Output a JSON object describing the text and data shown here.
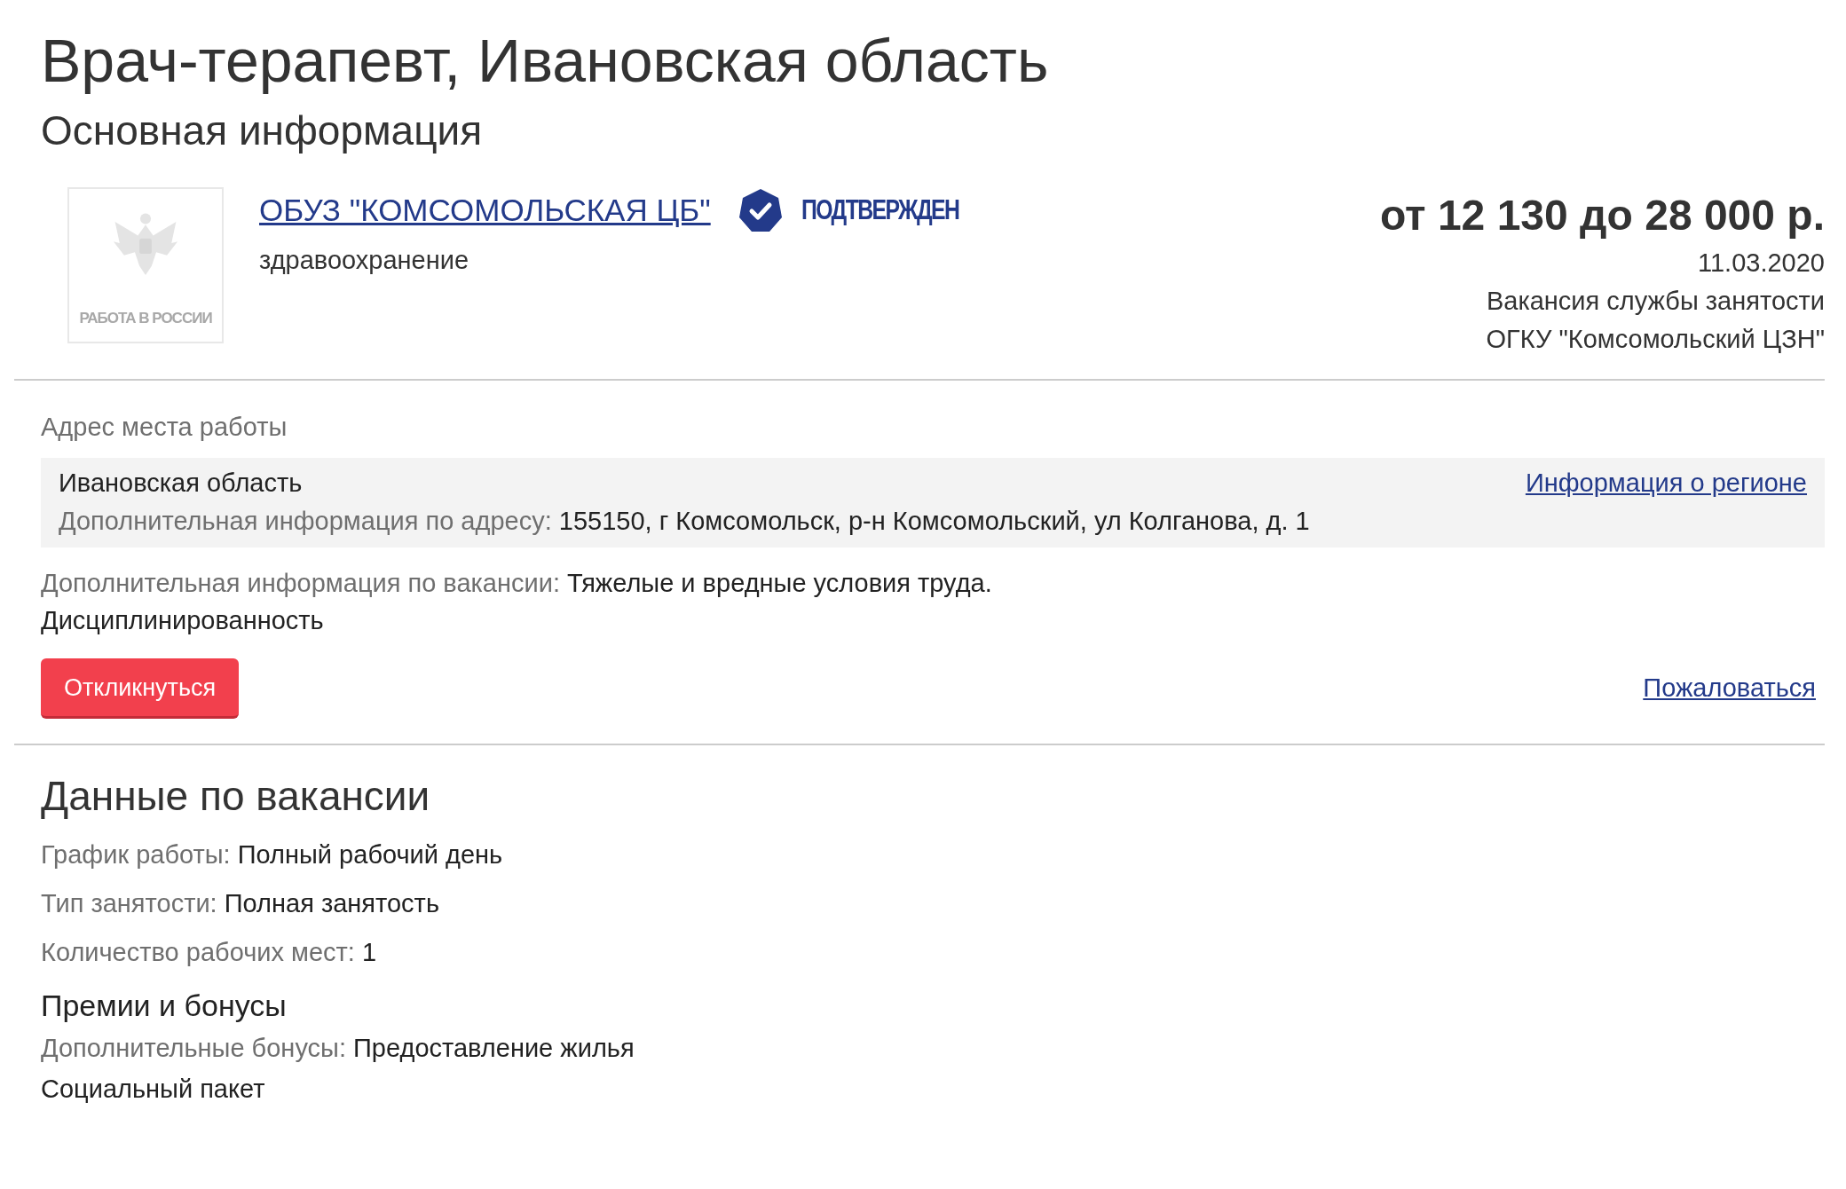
{
  "title": "Врач-терапевт, Ивановская область",
  "section_title": "Основная информация",
  "employer": {
    "logo_caption": "РАБОТА В РОССИИ",
    "name": "ОБУЗ \"КОМСОМОЛЬСКАЯ ЦБ\"",
    "industry": "здравоохранение",
    "badge": "ПОДТВЕРЖДЕН",
    "verified": true
  },
  "salary": "от 12 130 до 28 000 р.",
  "date": "11.03.2020",
  "source": [
    "Вакансия службы занятости",
    "ОГКУ \"Комсомольский ЦЗН\""
  ],
  "address": {
    "label": "Адрес места работы",
    "region": "Ивановская область",
    "region_link": "Информация о регионе",
    "extra_label": "Дополнительная информация по адресу:",
    "extra_value": "155150, г Комсомольск, р-н Комсомольский, ул Колганова, д. 1"
  },
  "vacancy_info": {
    "label": "Дополнительная информация по вакансии:",
    "lines": [
      "Тяжелые и вредные условия труда.",
      "Дисциплинированность"
    ]
  },
  "respond_button": "Откликнуться",
  "complain_link": "Пожаловаться",
  "details_title": "Данные по вакансии",
  "details": [
    {
      "label": "График работы:",
      "value": "Полный рабочий день"
    },
    {
      "label": "Тип занятости:",
      "value": "Полная занятость"
    },
    {
      "label": "Количество рабочих мест:",
      "value": "1"
    }
  ],
  "bonuses_title": "Премии и бонусы",
  "bonuses": {
    "label": "Дополнительные бонусы:",
    "lines": [
      "Предоставление жилья",
      "Социальный пакет"
    ]
  }
}
